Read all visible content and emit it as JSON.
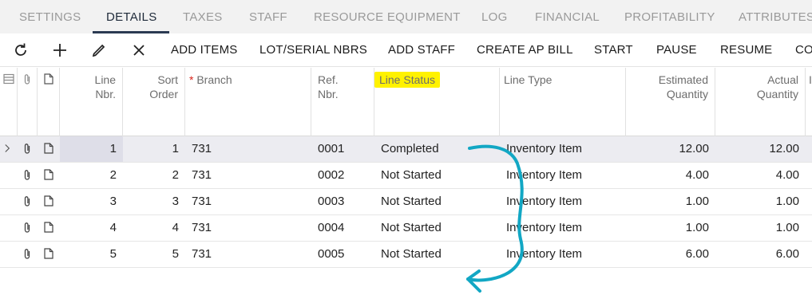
{
  "tabs": [
    {
      "label": "SETTINGS",
      "active": false
    },
    {
      "label": "DETAILS",
      "active": true
    },
    {
      "label": "TAXES",
      "active": false
    },
    {
      "label": "STAFF",
      "active": false
    },
    {
      "label": "RESOURCE EQUIPMENT",
      "active": false
    },
    {
      "label": "LOG",
      "active": false
    },
    {
      "label": "FINANCIAL",
      "active": false
    },
    {
      "label": "PROFITABILITY",
      "active": false
    },
    {
      "label": "ATTRIBUTES",
      "active": false
    }
  ],
  "toolbar": {
    "icons": [
      "refresh-icon",
      "add-icon",
      "edit-icon",
      "close-icon"
    ],
    "buttons": [
      "ADD ITEMS",
      "LOT/SERIAL NBRS",
      "ADD STAFF",
      "CREATE AP BILL",
      "START",
      "PAUSE",
      "RESUME",
      "CO"
    ]
  },
  "grid": {
    "headers": {
      "line_nbr": "Line Nbr.",
      "line_nbr_1": "Line",
      "line_nbr_2": "Nbr.",
      "sort_order_1": "Sort",
      "sort_order_2": "Order",
      "branch": "Branch",
      "branch_required": "*",
      "ref_nbr_1": "Ref.",
      "ref_nbr_2": "Nbr.",
      "line_status": "Line Status",
      "line_type": "Line Type",
      "estimated_quantity_1": "Estimated",
      "estimated_quantity_2": "Quantity",
      "actual_quantity_1": "Actual",
      "actual_quantity_2": "Quantity",
      "overflow": "I"
    },
    "rows": [
      {
        "line_nbr": "1",
        "sort_order": "1",
        "branch": "731",
        "ref_nbr": "0001",
        "line_status": "Completed",
        "line_type": "Inventory Item",
        "estimated_quantity": "12.00",
        "actual_quantity": "12.00"
      },
      {
        "line_nbr": "2",
        "sort_order": "2",
        "branch": "731",
        "ref_nbr": "0002",
        "line_status": "Not Started",
        "line_type": "Inventory Item",
        "estimated_quantity": "4.00",
        "actual_quantity": "4.00"
      },
      {
        "line_nbr": "3",
        "sort_order": "3",
        "branch": "731",
        "ref_nbr": "0003",
        "line_status": "Not Started",
        "line_type": "Inventory Item",
        "estimated_quantity": "1.00",
        "actual_quantity": "1.00"
      },
      {
        "line_nbr": "4",
        "sort_order": "4",
        "branch": "731",
        "ref_nbr": "0004",
        "line_status": "Not Started",
        "line_type": "Inventory Item",
        "estimated_quantity": "1.00",
        "actual_quantity": "1.00"
      },
      {
        "line_nbr": "5",
        "sort_order": "5",
        "branch": "731",
        "ref_nbr": "0005",
        "line_status": "Not Started",
        "line_type": "Inventory Item",
        "estimated_quantity": "6.00",
        "actual_quantity": "6.00"
      }
    ]
  },
  "colors": {
    "highlight": "#fff200",
    "annotation_arrow": "#12a7c4",
    "active_tab_underline": "#2b3a52"
  }
}
